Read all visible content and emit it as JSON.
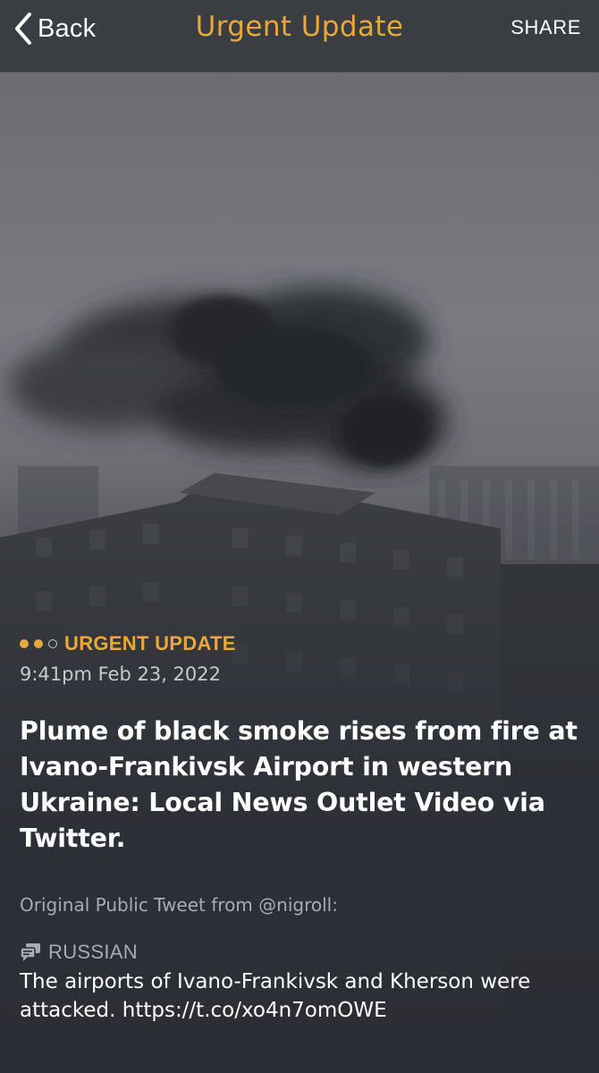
{
  "navbar": {
    "back_label": "Back",
    "title": "Urgent Update",
    "share_label": "SHARE"
  },
  "colors": {
    "accent": "#e8a93a",
    "navbar_bg": "#3a3d42",
    "body_text": "#ffffff",
    "muted_text": "#a9abb0"
  },
  "article": {
    "category": "URGENT UPDATE",
    "timestamp": "9:41pm Feb 23, 2022",
    "headline": "Plume of black smoke rises from fire at Ivano-Frankivsk Airport in western Ukraine: Local News Outlet Video via Twitter.",
    "source": "Original Public Tweet from @nigroll:",
    "language": "RUSSIAN",
    "tweet_text": "The airports of Ivano-Frankivsk and Kherson were attacked. https://t.co/xo4n7omOWE"
  },
  "icons": {
    "back": "chevron-left-icon",
    "translate": "speech-bubbles-icon"
  }
}
